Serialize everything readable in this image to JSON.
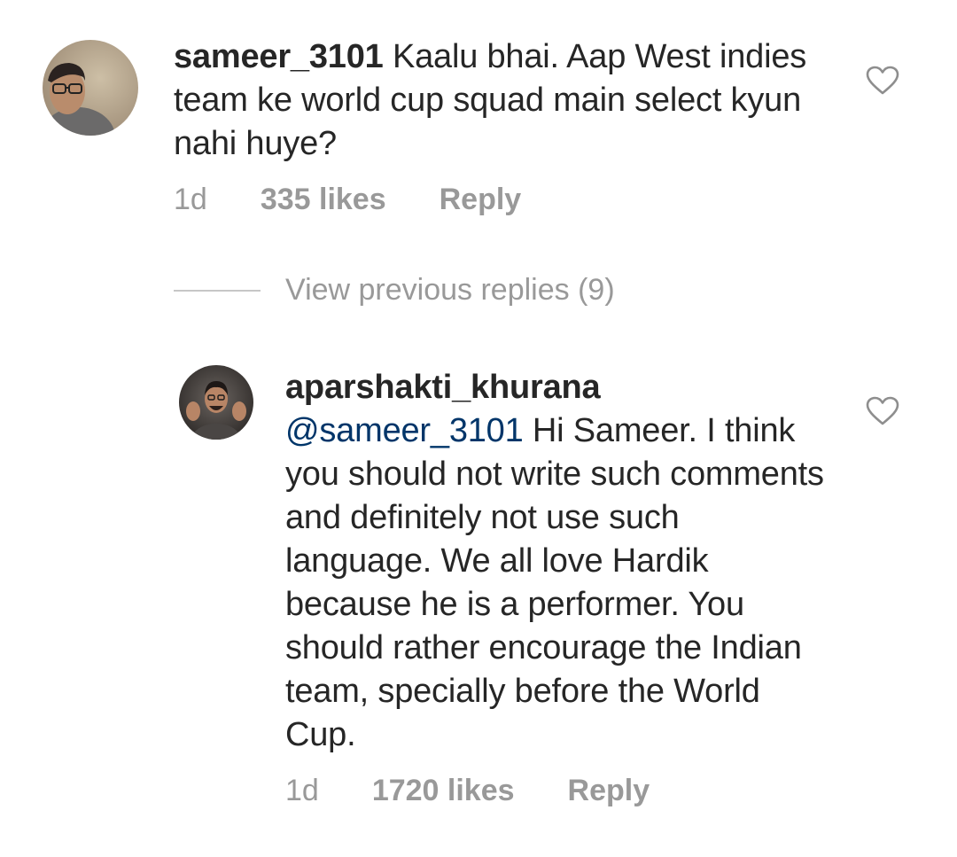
{
  "comments": [
    {
      "username": "sameer_3101",
      "text": " Kaalu bhai. Aap West indies team ke world cup squad main select kyun nahi huye?",
      "time": "1d",
      "likes": "335 likes",
      "reply": "Reply",
      "avatar_icon": "user-avatar-photo",
      "like_icon": "heart-outline-icon"
    },
    {
      "username": "aparshakti_khurana",
      "mention": "@sameer_3101",
      "text": " Hi Sameer. I think you should not write such comments and definitely not use such language. We all love Hardik because he is a performer. You should rather encourage the Indian team, specially before the World Cup.",
      "time": "1d",
      "likes": "1720 likes",
      "reply": "Reply",
      "avatar_icon": "user-avatar-photo",
      "like_icon": "heart-outline-icon"
    }
  ],
  "view_previous_replies": "View previous replies (9)",
  "colors": {
    "text": "#262626",
    "meta": "#999999",
    "mention": "#003569",
    "divider": "#c7c7c7",
    "heart": "#8e8e8e"
  }
}
